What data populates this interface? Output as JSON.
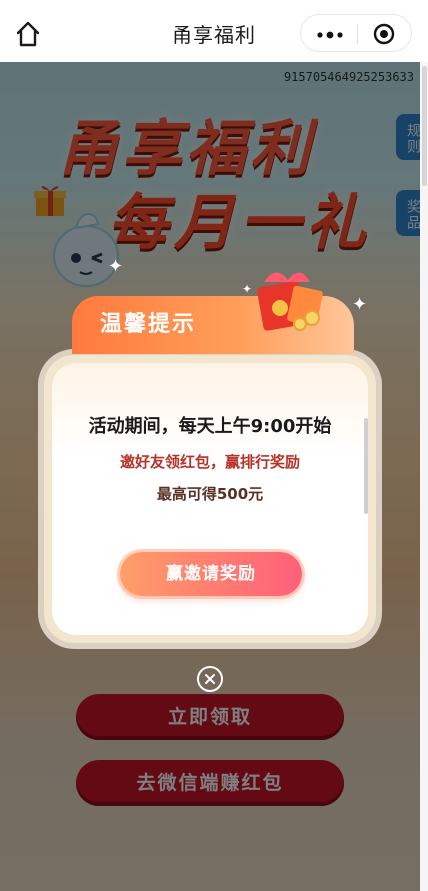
{
  "header": {
    "title": "甬享福利",
    "home_icon": "home-icon",
    "more_icon": "more-dots-icon",
    "close_icon": "miniprogram-close-icon"
  },
  "background": {
    "order_number": "915705464925253633",
    "hero_line1": "甬享福利",
    "hero_line2": "每月一礼",
    "side_tabs": [
      "规则",
      "奖品"
    ],
    "buttons": {
      "claim": "立即领取",
      "wechat": "去微信端赚红包"
    }
  },
  "popup": {
    "title": "温馨提示",
    "line1": "活动期间，每天上午9:00开始",
    "line2": "邀好友领红包，赢排行奖励",
    "line3": "最高可得500元",
    "cta": "赢邀请奖励",
    "close_icon": "close-icon"
  },
  "colors": {
    "accent_orange": "#ff7a3d",
    "cta_gradient_start": "#ff9e68",
    "cta_gradient_end": "#ff5f7a",
    "highlight_red": "#b8322a",
    "button_red": "#c9152b"
  }
}
